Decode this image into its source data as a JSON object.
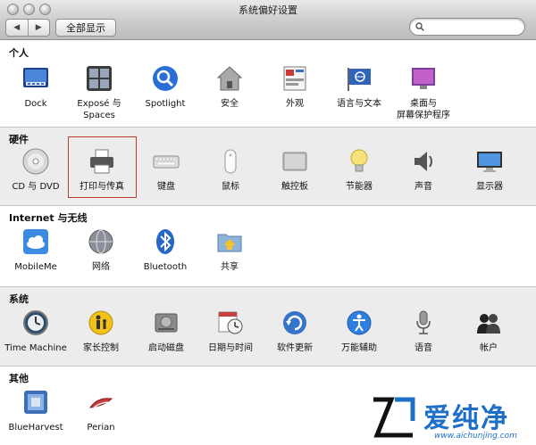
{
  "window": {
    "title": "系统偏好设置",
    "show_all": "全部显示",
    "search_placeholder": "",
    "nav_back": "◀",
    "nav_forward": "▶"
  },
  "sections": [
    {
      "title": "个人",
      "items": [
        {
          "label": "Dock",
          "icon": "dock-icon"
        },
        {
          "label": "Exposé 与\nSpaces",
          "icon": "expose-icon"
        },
        {
          "label": "Spotlight",
          "icon": "spotlight-icon"
        },
        {
          "label": "安全",
          "icon": "security-house-icon"
        },
        {
          "label": "外观",
          "icon": "appearance-icon"
        },
        {
          "label": "语言与文本",
          "icon": "language-flag-icon"
        },
        {
          "label": "桌面与\n屏幕保护程序",
          "icon": "desktop-screensaver-icon"
        }
      ]
    },
    {
      "title": "硬件",
      "items": [
        {
          "label": "CD 与 DVD",
          "icon": "cd-dvd-icon"
        },
        {
          "label": "打印与传真",
          "icon": "printer-icon"
        },
        {
          "label": "键盘",
          "icon": "keyboard-icon"
        },
        {
          "label": "鼠标",
          "icon": "mouse-icon"
        },
        {
          "label": "触控板",
          "icon": "trackpad-icon"
        },
        {
          "label": "节能器",
          "icon": "lightbulb-icon"
        },
        {
          "label": "声音",
          "icon": "speaker-icon"
        },
        {
          "label": "显示器",
          "icon": "display-icon"
        }
      ]
    },
    {
      "title": "Internet 与无线",
      "items": [
        {
          "label": "MobileMe",
          "icon": "cloud-icon"
        },
        {
          "label": "网络",
          "icon": "network-globe-icon"
        },
        {
          "label": "Bluetooth",
          "icon": "bluetooth-icon"
        },
        {
          "label": "共享",
          "icon": "sharing-folder-icon"
        }
      ]
    },
    {
      "title": "系统",
      "items": [
        {
          "label": "Time Machine",
          "icon": "time-machine-icon"
        },
        {
          "label": "家长控制",
          "icon": "parental-controls-icon"
        },
        {
          "label": "启动磁盘",
          "icon": "startup-disk-icon"
        },
        {
          "label": "日期与时间",
          "icon": "date-time-icon"
        },
        {
          "label": "软件更新",
          "icon": "software-update-icon"
        },
        {
          "label": "万能辅助",
          "icon": "accessibility-icon"
        },
        {
          "label": "语音",
          "icon": "microphone-icon"
        },
        {
          "label": "帐户",
          "icon": "accounts-icon"
        }
      ]
    },
    {
      "title": "其他",
      "items": [
        {
          "label": "BlueHarvest",
          "icon": "blueharvest-icon"
        },
        {
          "label": "Perian",
          "icon": "perian-icon"
        }
      ]
    }
  ],
  "watermark": {
    "text": "爱纯净",
    "url": "www.aichunjing.com"
  }
}
